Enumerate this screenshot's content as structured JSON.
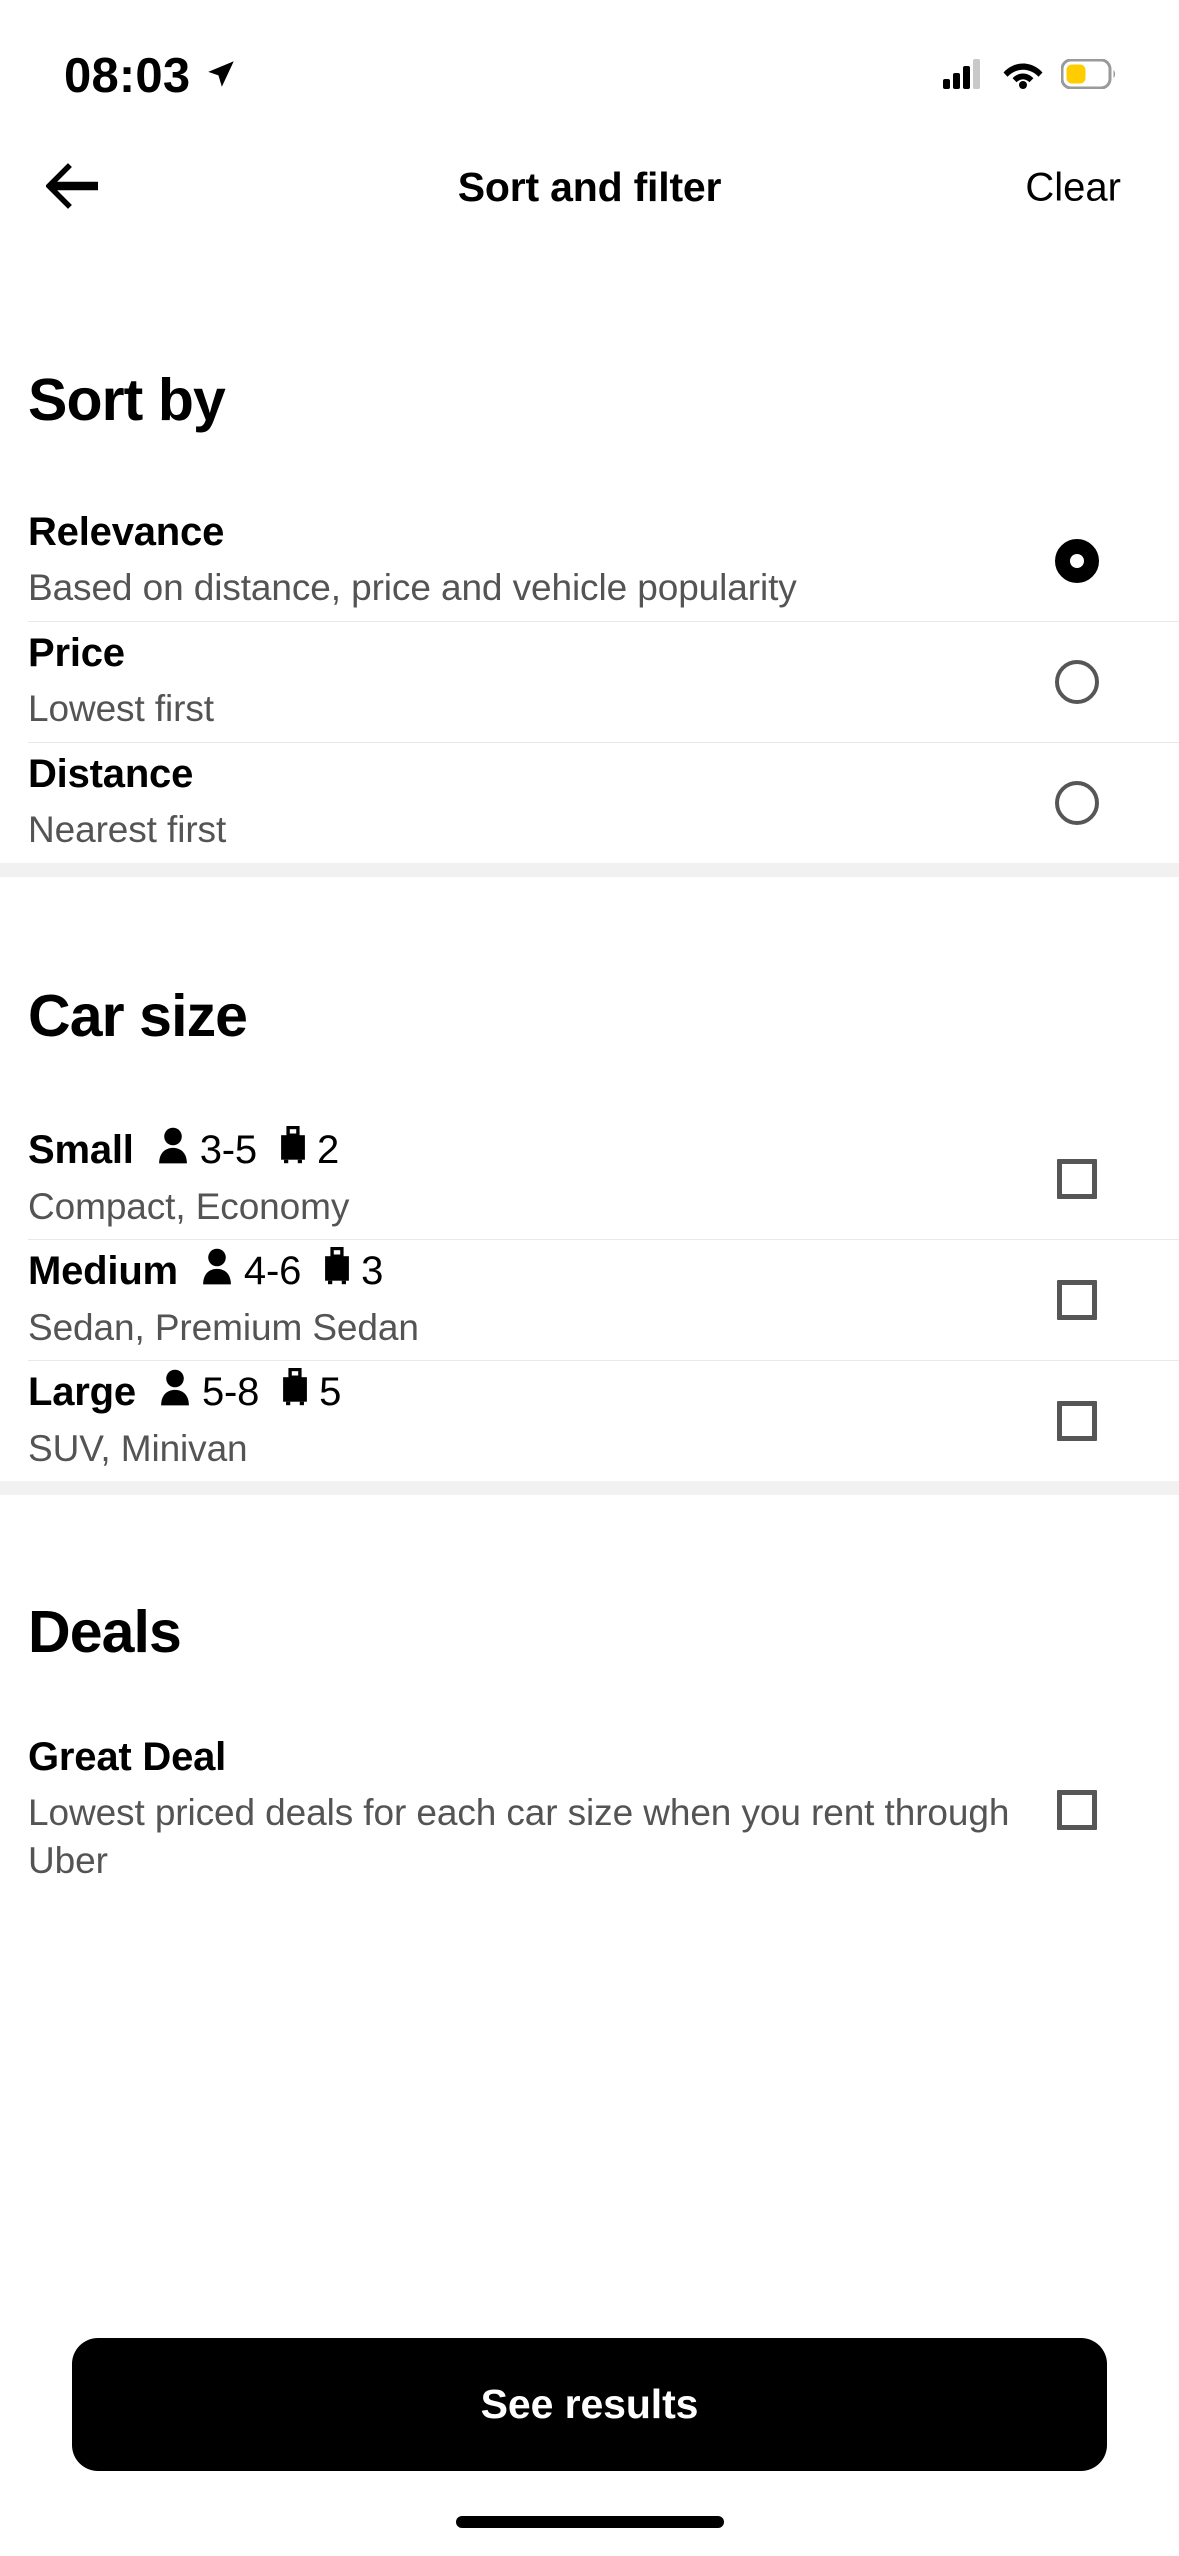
{
  "status_bar": {
    "time": "08:03",
    "location_icon": "location-arrow-icon",
    "signal_icon": "cellular-signal-icon",
    "wifi_icon": "wifi-icon",
    "battery_icon": "battery-low-power-icon",
    "battery_color": "#FFCC00"
  },
  "header": {
    "back_icon": "back-arrow-icon",
    "title": "Sort and filter",
    "clear_label": "Clear"
  },
  "sections": {
    "sort": {
      "title": "Sort by",
      "options": [
        {
          "label": "Relevance",
          "subtitle": "Based on distance, price and vehicle popularity",
          "selected": true
        },
        {
          "label": "Price",
          "subtitle": "Lowest first",
          "selected": false
        },
        {
          "label": "Distance",
          "subtitle": "Nearest first",
          "selected": false
        }
      ]
    },
    "car_size": {
      "title": "Car size",
      "passenger_icon": "person-icon",
      "luggage_icon": "suitcase-icon",
      "options": [
        {
          "label": "Small",
          "passengers": "3-5",
          "luggage": "2",
          "subtitle": "Compact, Economy",
          "checked": false
        },
        {
          "label": "Medium",
          "passengers": "4-6",
          "luggage": "3",
          "subtitle": "Sedan, Premium Sedan",
          "checked": false
        },
        {
          "label": "Large",
          "passengers": "5-8",
          "luggage": "5",
          "subtitle": "SUV, Minivan",
          "checked": false
        }
      ]
    },
    "deals": {
      "title": "Deals",
      "options": [
        {
          "label": "Great Deal",
          "subtitle": "Lowest priced deals for each car size when you rent through Uber",
          "checked": false
        }
      ]
    }
  },
  "footer": {
    "cta_label": "See results"
  },
  "colors": {
    "accent": "#000000",
    "background": "#FFFFFF",
    "subtitle_text": "#545454",
    "divider": "#E8E8E8",
    "section_gap": "#F1F1F1",
    "control_border": "#565656"
  }
}
